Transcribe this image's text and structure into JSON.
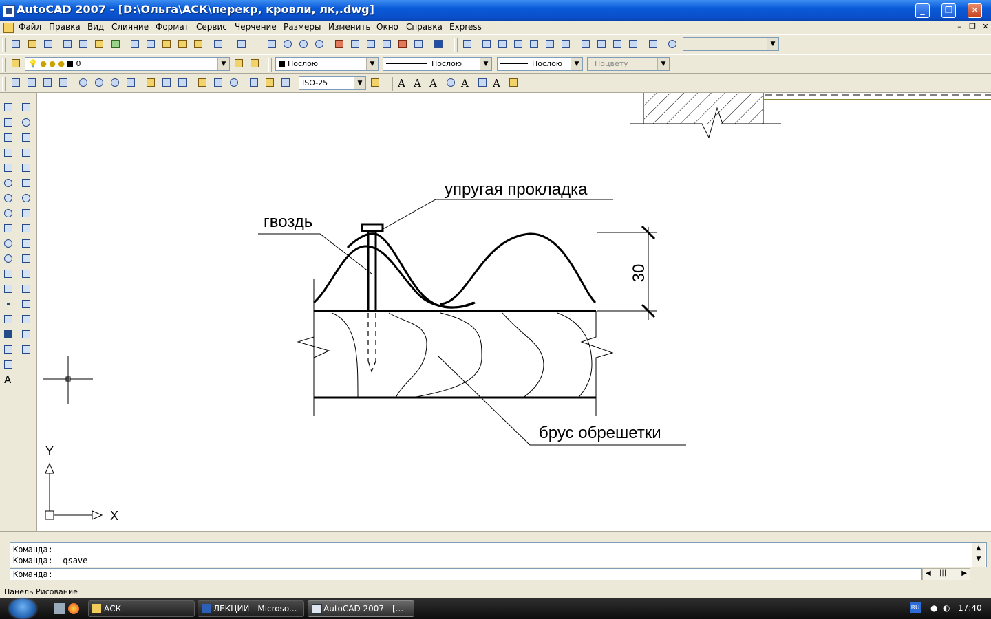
{
  "window": {
    "title": "AutoCAD 2007 - [D:\\Ольга\\АСК\\перекр, кровли, лк,.dwg]"
  },
  "menu": {
    "items": [
      "Файл",
      "Правка",
      "Вид",
      "Слияние",
      "Формат",
      "Сервис",
      "Черчение",
      "Размеры",
      "Изменить",
      "Окно",
      "Справка",
      "Express"
    ]
  },
  "properties_bar": {
    "layer": "0",
    "color": "Послою",
    "linetype": "Послою",
    "lineweight": "Послою",
    "plotstyle": "Поцвету"
  },
  "styles_bar": {
    "dimstyle": "ISO-25"
  },
  "drawing": {
    "label_spacer": "упругая прокладка",
    "label_nail": "гвоздь",
    "label_batten": "брус обрешетки",
    "dimension_value": "30",
    "ucs_x": "X",
    "ucs_y": "Y"
  },
  "command": {
    "history": [
      "Команда:",
      "Команда: _qsave"
    ],
    "prompt": "Команда:"
  },
  "status": {
    "text": "Панель Рисование"
  },
  "taskbar": {
    "buttons": [
      {
        "label": "АСК"
      },
      {
        "label": "ЛЕКЦИИ - Microso..."
      },
      {
        "label": "AutoCAD 2007 - [..."
      }
    ],
    "lang": "RU",
    "clock": "17:40"
  },
  "colors": {
    "title_bar": "#0a5ad8",
    "canvas_bg": "#ffffff",
    "wall_accent": "#8c8a2a",
    "taskbar": "#1a1a1a"
  }
}
